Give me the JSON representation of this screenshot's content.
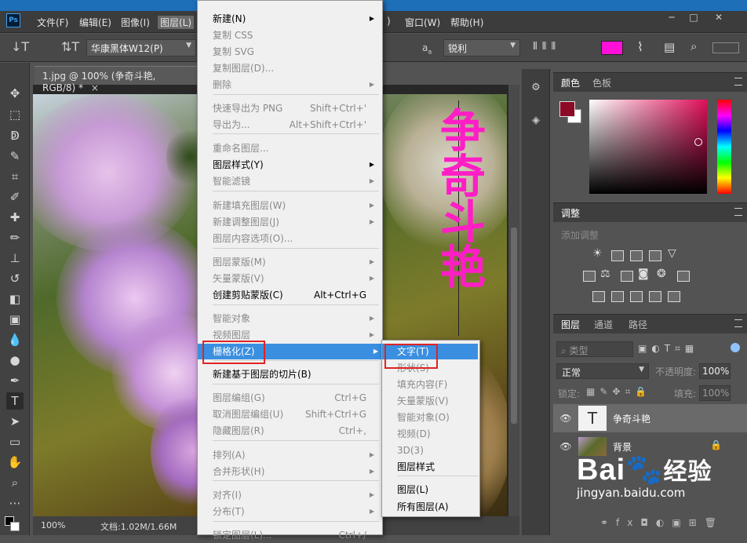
{
  "menubar": {
    "items": [
      "文件(F)",
      "编辑(E)",
      "图像(I)",
      "图层(L)",
      "窗口(W)",
      "帮助(H)"
    ],
    "ps_logo": "Ps",
    "window_controls": [
      "─",
      "□",
      "✕"
    ]
  },
  "options": {
    "font_family": "华康黑体W12(P)",
    "aa_label": "a",
    "aa_sub": "a",
    "antialias": "锐利",
    "text_color": "#ff10d8"
  },
  "document": {
    "tab": "1.jpg @ 100% (争奇斗艳, RGB/8) *",
    "zoom": "100%",
    "doc_size": "文档:1.02M/1.66M",
    "headline": "争奇斗艳"
  },
  "layer_menu": {
    "items": [
      {
        "label": "新建(N)",
        "shortcut": "",
        "arrow": true,
        "disabled": false
      },
      {
        "label": "复制 CSS",
        "shortcut": "",
        "arrow": false,
        "disabled": true
      },
      {
        "label": "复制 SVG",
        "shortcut": "",
        "arrow": false,
        "disabled": true
      },
      {
        "label": "复制图层(D)...",
        "shortcut": "",
        "arrow": false,
        "disabled": true
      },
      {
        "label": "删除",
        "shortcut": "",
        "arrow": true,
        "disabled": true
      },
      {
        "label": "快速导出为 PNG",
        "shortcut": "Shift+Ctrl+'",
        "arrow": false,
        "disabled": true
      },
      {
        "label": "导出为...",
        "shortcut": "Alt+Shift+Ctrl+'",
        "arrow": false,
        "disabled": true
      },
      {
        "label": "重命名图层...",
        "shortcut": "",
        "arrow": false,
        "disabled": true
      },
      {
        "label": "图层样式(Y)",
        "shortcut": "",
        "arrow": true,
        "disabled": false
      },
      {
        "label": "智能滤镜",
        "shortcut": "",
        "arrow": true,
        "disabled": true
      },
      {
        "label": "新建填充图层(W)",
        "shortcut": "",
        "arrow": true,
        "disabled": true
      },
      {
        "label": "新建调整图层(J)",
        "shortcut": "",
        "arrow": true,
        "disabled": true
      },
      {
        "label": "图层内容选项(O)...",
        "shortcut": "",
        "arrow": false,
        "disabled": true
      },
      {
        "label": "图层蒙版(M)",
        "shortcut": "",
        "arrow": true,
        "disabled": true
      },
      {
        "label": "矢量蒙版(V)",
        "shortcut": "",
        "arrow": true,
        "disabled": true
      },
      {
        "label": "创建剪贴蒙版(C)",
        "shortcut": "Alt+Ctrl+G",
        "arrow": false,
        "disabled": false
      },
      {
        "label": "智能对象",
        "shortcut": "",
        "arrow": true,
        "disabled": true
      },
      {
        "label": "视频图层",
        "shortcut": "",
        "arrow": true,
        "disabled": true
      },
      {
        "label": "栅格化(Z)",
        "shortcut": "",
        "arrow": true,
        "disabled": false
      },
      {
        "label": "新建基于图层的切片(B)",
        "shortcut": "",
        "arrow": false,
        "disabled": false
      },
      {
        "label": "图层编组(G)",
        "shortcut": "Ctrl+G",
        "arrow": false,
        "disabled": true
      },
      {
        "label": "取消图层编组(U)",
        "shortcut": "Shift+Ctrl+G",
        "arrow": false,
        "disabled": true
      },
      {
        "label": "隐藏图层(R)",
        "shortcut": "Ctrl+,",
        "arrow": false,
        "disabled": true
      },
      {
        "label": "排列(A)",
        "shortcut": "",
        "arrow": true,
        "disabled": true
      },
      {
        "label": "合并形状(H)",
        "shortcut": "",
        "arrow": true,
        "disabled": true
      },
      {
        "label": "对齐(I)",
        "shortcut": "",
        "arrow": true,
        "disabled": true
      },
      {
        "label": "分布(T)",
        "shortcut": "",
        "arrow": true,
        "disabled": true
      },
      {
        "label": "锁定图层(L)...",
        "shortcut": "Ctrl+/",
        "arrow": false,
        "disabled": true
      }
    ]
  },
  "rasterize_menu": {
    "items": [
      {
        "label": "文字(T)",
        "disabled": false
      },
      {
        "label": "形状(S)",
        "disabled": true
      },
      {
        "label": "填充内容(F)",
        "disabled": true
      },
      {
        "label": "矢量蒙版(V)",
        "disabled": true
      },
      {
        "label": "智能对象(O)",
        "disabled": true
      },
      {
        "label": "视频(D)",
        "disabled": true
      },
      {
        "label": "3D(3)",
        "disabled": true
      },
      {
        "label": "图层样式",
        "disabled": false
      },
      {
        "label": "图层(L)",
        "disabled": false
      },
      {
        "label": "所有图层(A)",
        "disabled": false
      }
    ]
  },
  "color_panel": {
    "tabs": [
      "颜色",
      "色板"
    ],
    "fg": "#8c0a25",
    "bg": "#ffffff"
  },
  "adjust_panel": {
    "title": "调整",
    "subtitle": "添加调整"
  },
  "layers_panel": {
    "tabs": [
      "图层",
      "通道",
      "路径"
    ],
    "filter": "类型",
    "blend": "正常",
    "opacity_label": "不透明度:",
    "opacity": "100%",
    "lock_label": "锁定:",
    "fill_label": "填充:",
    "fill": "100%",
    "layers": [
      {
        "name": "争奇斗艳",
        "type": "text"
      },
      {
        "name": "背景",
        "type": "image"
      }
    ]
  },
  "watermark": {
    "brand": "Bai",
    "brand2": "经验",
    "url": "jingyan.baidu.com"
  }
}
